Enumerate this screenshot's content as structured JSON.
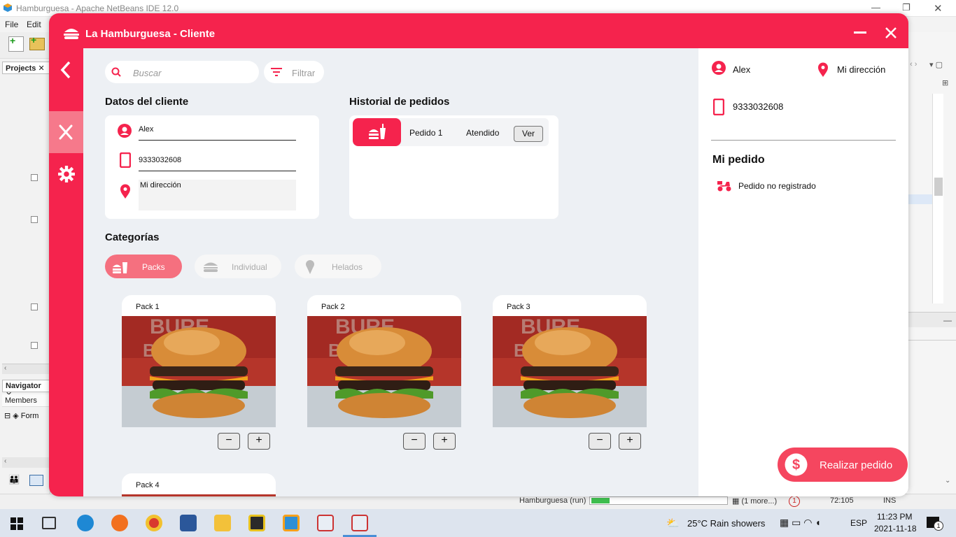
{
  "ide": {
    "window_title": "Hamburguesa - Apache NetBeans IDE 12.0",
    "menu": [
      "File",
      "Edit"
    ],
    "projects_tab": "Projects",
    "navigator_tab": "Navigator",
    "members_label": "Members",
    "form_item": "Form",
    "status": {
      "run": "Hamburguesa (run)",
      "more": "(1 more...)",
      "notifications": "1",
      "position": "72:105",
      "mode": "INS"
    }
  },
  "app": {
    "title": "La Hamburguesa - Cliente",
    "search_placeholder": "Buscar",
    "filter_label": "Filtrar",
    "client_section_title": "Datos del cliente",
    "client": {
      "name": "Alex",
      "phone": "9333032608",
      "address": "Mi dirección"
    },
    "history_title": "Historial de pedidos",
    "history": [
      {
        "order": "Pedido 1",
        "status": "Atendido",
        "action": "Ver"
      }
    ],
    "categories_title": "Categorías",
    "categories": [
      {
        "label": "Packs",
        "icon": "fast-food-icon",
        "active": true
      },
      {
        "label": "Individual",
        "icon": "burger-icon",
        "active": false
      },
      {
        "label": "Helados",
        "icon": "ice-cream-icon",
        "active": false
      }
    ],
    "products": [
      {
        "name": "Pack 1",
        "minus": "−",
        "plus": "+"
      },
      {
        "name": "Pack 2",
        "minus": "−",
        "plus": "+"
      },
      {
        "name": "Pack 3",
        "minus": "−",
        "plus": "+"
      },
      {
        "name": "Pack 4"
      }
    ],
    "right_panel": {
      "user": "Alex",
      "address": "Mi dirección",
      "phone": "9333032608",
      "order_title": "Mi pedido",
      "order_status": "Pedido no registrado",
      "checkout_label": "Realizar pedido"
    },
    "accent_color": "#f5234d"
  },
  "taskbar": {
    "weather": "25°C  Rain showers",
    "language": "ESP",
    "time": "11:23 PM",
    "date": "2021-11-18",
    "notifications": "1"
  }
}
